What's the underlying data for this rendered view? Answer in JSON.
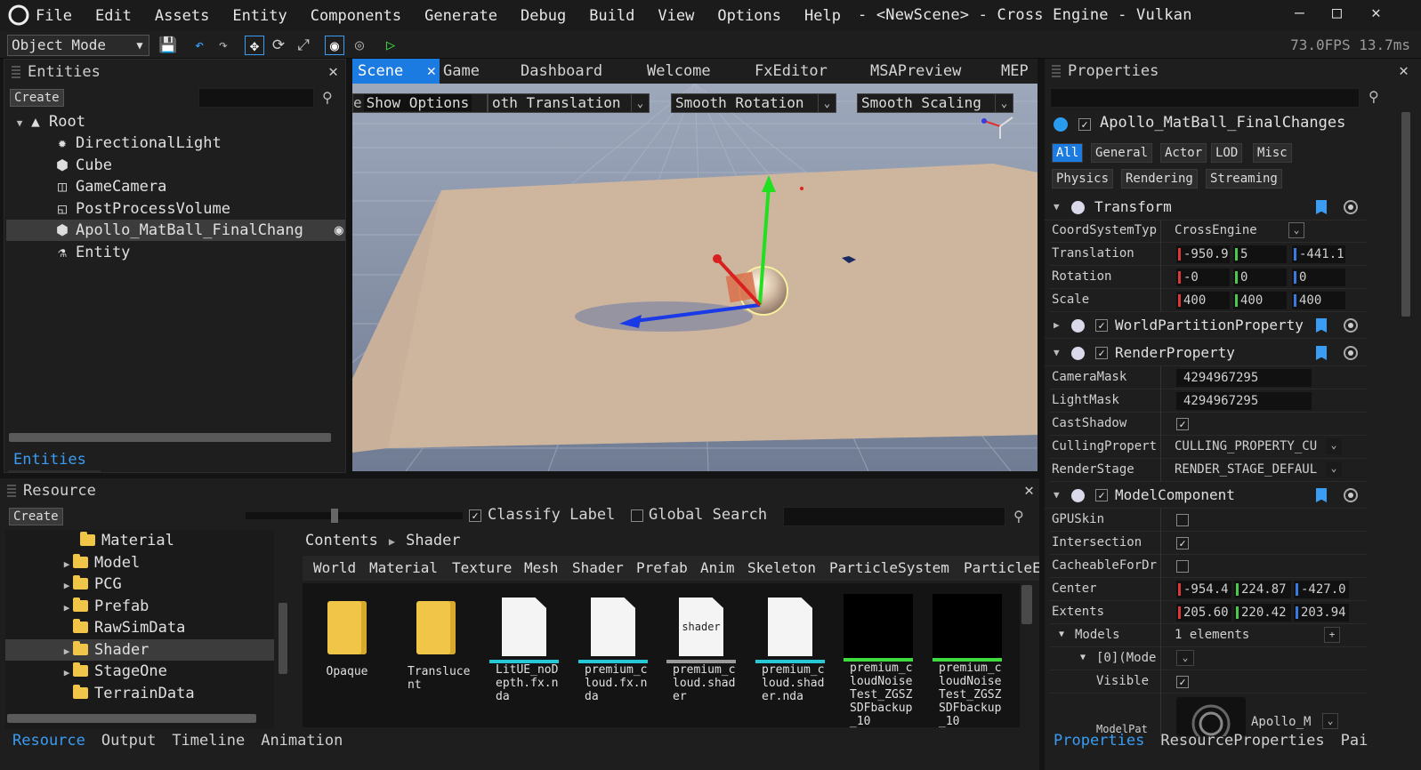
{
  "menubar": {
    "items": [
      "File",
      "Edit",
      "Assets",
      "Entity",
      "Components",
      "Generate",
      "Debug",
      "Build",
      "View",
      "Options",
      "Help"
    ],
    "title": "- <NewScene> - Cross Engine - Vulkan",
    "minimize": "–",
    "maximize": "□",
    "close": "✕"
  },
  "toolbar": {
    "mode": "Object Mode",
    "fps": "73.0FPS 13.7ms"
  },
  "entities": {
    "title": "Entities",
    "create": "Create",
    "root": "Root",
    "items": [
      {
        "label": "DirectionalLight",
        "icon": "sun-icon"
      },
      {
        "label": "Cube",
        "icon": "cube-icon"
      },
      {
        "label": "GameCamera",
        "icon": "camera-icon"
      },
      {
        "label": "PostProcessVolume",
        "icon": "volume-icon"
      },
      {
        "label": "Apollo_MatBall_FinalChang",
        "icon": "cube-icon"
      },
      {
        "label": "Entity",
        "icon": "entity-icon"
      }
    ],
    "footer_tab": "Entities"
  },
  "scene": {
    "tabs": [
      "Scene",
      "Game",
      "Dashboard",
      "Welcome",
      "FxEditor",
      "MSAPreview",
      "MEP"
    ],
    "show_options": "Show Options",
    "smooth_translation": "oth Translation",
    "smooth_rotation": "Smooth Rotation",
    "smooth_scaling": "Smooth Scaling",
    "show_prefix": "e"
  },
  "properties": {
    "title": "Properties",
    "entity_name": "Apollo_MatBall_FinalChanges",
    "filter_tabs_row1": [
      "All",
      "General",
      "Actor",
      "LOD",
      "Misc"
    ],
    "filter_tabs_row2": [
      "Physics",
      "Rendering",
      "Streaming"
    ],
    "transform": {
      "label": "Transform",
      "coord_key": "CoordSystemTyp",
      "coord_val": "CrossEngine",
      "translation_key": "Translation",
      "translation": [
        "-950.9",
        "5",
        "-441.1"
      ],
      "rotation_key": "Rotation",
      "rotation": [
        "-0",
        "0",
        "0"
      ],
      "scale_key": "Scale",
      "scale": [
        "400",
        "400",
        "400"
      ]
    },
    "world_partition": "WorldPartitionProperty",
    "render_property": {
      "label": "RenderProperty",
      "camera_mask_key": "CameraMask",
      "camera_mask": "4294967295",
      "light_mask_key": "LightMask",
      "light_mask": "4294967295",
      "cast_shadow_key": "CastShadow",
      "culling_key": "CullingPropert",
      "culling_val": "CULLING_PROPERTY_CU",
      "render_stage_key": "RenderStage",
      "render_stage_val": "RENDER_STAGE_DEFAUL"
    },
    "model_component": {
      "label": "ModelComponent",
      "gpuskin_key": "GPUSkin",
      "intersection_key": "Intersection",
      "cacheable_key": "CacheableForDr",
      "center_key": "Center",
      "center": [
        "-954.4",
        "224.87",
        "-427.0"
      ],
      "extents_key": "Extents",
      "extents": [
        "205.60",
        "220.42",
        "203.94"
      ],
      "models_key": "Models",
      "models_val": "1 elements",
      "add": "+",
      "model0_key": "[0](Mode",
      "visible_key": "Visible",
      "modelpath_key": "ModelPat",
      "asset_name": "Apollo_M"
    },
    "footer_tabs": [
      "Properties",
      "ResourceProperties",
      "Pai"
    ]
  },
  "resource": {
    "title": "Resource",
    "create": "Create",
    "classify_label": "Classify Label",
    "global_search": "Global Search",
    "folders": [
      "Material",
      "Model",
      "PCG",
      "Prefab",
      "RawSimData",
      "Shader",
      "StageOne",
      "TerrainData"
    ],
    "breadcrumb_root": "Contents",
    "breadcrumb_leaf": "Shader",
    "category_tabs": [
      "World",
      "Material",
      "Texture",
      "Mesh",
      "Shader",
      "Prefab",
      "Anim",
      "Skeleton",
      "ParticleSystem",
      "ParticleE"
    ],
    "files": [
      {
        "name": "Opaque",
        "kind": "folder"
      },
      {
        "name": "Translucent",
        "kind": "folder"
      },
      {
        "name": "LitUE_noDepth.fx.nda",
        "kind": "doc",
        "accent": "#27c9d6"
      },
      {
        "name": "premium_cloud.fx.nda",
        "kind": "doc",
        "accent": "#27c9d6"
      },
      {
        "name": "premium_cloud.shader",
        "kind": "shader",
        "accent": "#9a9a9a",
        "badge": "shader"
      },
      {
        "name": "premium_cloud.shader.nda",
        "kind": "doc",
        "accent": "#27c9d6"
      },
      {
        "name": "premium_cloudNoiseTest_ZGSZSDFbackup_10",
        "kind": "thumb",
        "accent": "#3fdc3f"
      },
      {
        "name": "premium_cloudNoiseTest_ZGSZSDFbackup_10",
        "kind": "thumb",
        "accent": "#3fdc3f"
      }
    ],
    "footer_tabs": [
      "Resource",
      "Output",
      "Timeline",
      "Animation"
    ]
  },
  "colors": {
    "accent": "#1c7be0",
    "link": "#3a9cf2"
  }
}
